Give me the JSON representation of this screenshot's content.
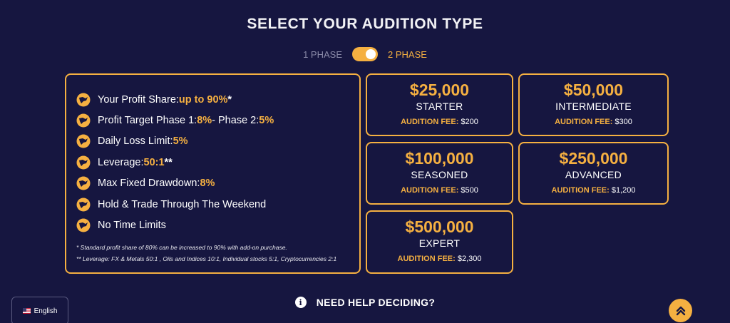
{
  "page": {
    "title": "SELECT YOUR AUDITION TYPE",
    "toggle": {
      "option_1": "1 PHASE",
      "option_2": "2 PHASE",
      "selected": "2 PHASE"
    }
  },
  "features": [
    {
      "label": "Your Profit Share: ",
      "highlight": "up to 90%",
      "suffix": " *"
    },
    {
      "label": "Profit Target Phase 1: ",
      "highlight": "8%",
      "middle": " - Phase 2: ",
      "highlight2": "5%"
    },
    {
      "label": "Daily Loss Limit: ",
      "highlight": "5%"
    },
    {
      "label": "Leverage: ",
      "highlight": "50:1",
      "suffix": " **"
    },
    {
      "label": "Max Fixed Drawdown: ",
      "highlight": "8%"
    },
    {
      "label": "Hold & Trade Through The Weekend"
    },
    {
      "label": "No Time Limits"
    }
  ],
  "notes": {
    "note_1": "*  Standard profit share of 80% can be increased to 90% with add-on purchase.",
    "note_2": "** Leverage: FX & Metals 50:1 , Oils and Indices 10:1, Individual stocks 5:1, Cryptocurrencies 2:1"
  },
  "cards": [
    {
      "amount": "$25,000",
      "tier": "STARTER",
      "fee_label": "AUDITION FEE:",
      "fee_value": " $200"
    },
    {
      "amount": "$50,000",
      "tier": "INTERMEDIATE",
      "fee_label": "AUDITION FEE:",
      "fee_value": " $300"
    },
    {
      "amount": "$100,000",
      "tier": "SEASONED",
      "fee_label": "AUDITION FEE:",
      "fee_value": " $500"
    },
    {
      "amount": "$250,000",
      "tier": "ADVANCED",
      "fee_label": "AUDITION FEE:",
      "fee_value": " $1,200"
    },
    {
      "amount": "$500,000",
      "tier": "EXPERT",
      "fee_label": "AUDITION FEE:",
      "fee_value": " $2,300"
    }
  ],
  "footer": {
    "language": "English",
    "help_text": "NEED HELP DECIDING?",
    "info_glyph": "i"
  },
  "icons": {
    "feature_bullet": "bull-logo-icon",
    "info": "info-icon",
    "scroll_top": "chevron-up-icon",
    "flag": "us-flag-icon"
  },
  "colors": {
    "background": "#161640",
    "accent": "#f5b041",
    "text": "#ffffff",
    "muted": "#8a8aa8"
  }
}
